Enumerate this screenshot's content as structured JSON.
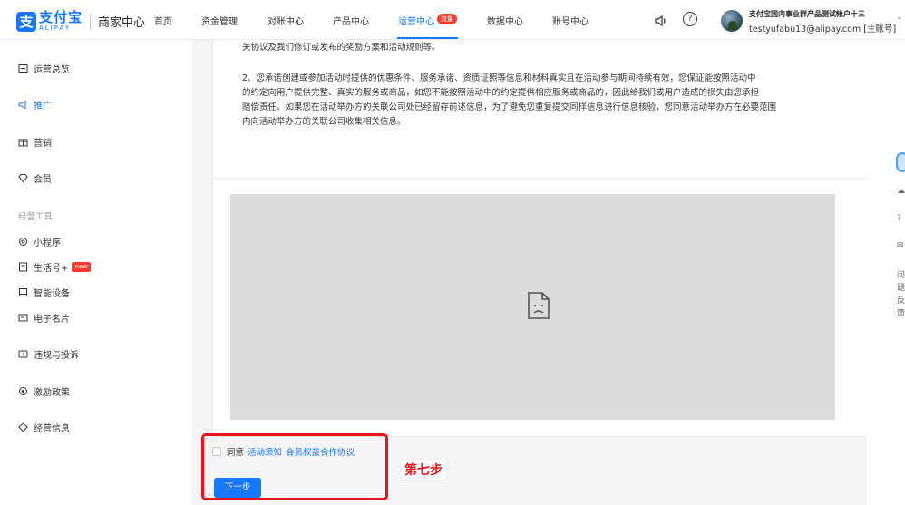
{
  "header": {
    "logo_cn": "支付宝",
    "logo_en": "ALIPAY",
    "app_name": "商家中心",
    "nav": [
      {
        "label": "首页"
      },
      {
        "label": "资金管理"
      },
      {
        "label": "对账中心"
      },
      {
        "label": "产品中心"
      },
      {
        "label": "运营中心",
        "active": true,
        "badge": "流量"
      },
      {
        "label": "数据中心"
      },
      {
        "label": "账号中心"
      }
    ],
    "help_symbol": "?",
    "account_name": "支付宝国内事业群产品测试帐户十三",
    "account_email": "testyufabu13@alipay.com [主账号]"
  },
  "sidebar": {
    "items": [
      {
        "label": "运营总览",
        "icon": "overview-icon"
      },
      {
        "label": "推广",
        "icon": "promotion-icon",
        "active": true
      },
      {
        "label": "营销",
        "icon": "marketing-icon"
      },
      {
        "label": "会员",
        "icon": "member-icon"
      }
    ],
    "group_title": "经营工具",
    "tools": [
      {
        "label": "小程序",
        "icon": "miniapp-icon"
      },
      {
        "label": "生活号+",
        "icon": "lifeaccount-icon",
        "badge": "new"
      },
      {
        "label": "智能设备",
        "icon": "device-icon"
      },
      {
        "label": "电子名片",
        "icon": "card-icon"
      }
    ],
    "bottom": [
      {
        "label": "违规与投诉",
        "icon": "complaint-icon"
      },
      {
        "label": "激励政策",
        "icon": "incentive-icon"
      },
      {
        "label": "经营信息",
        "icon": "business-info-icon"
      }
    ]
  },
  "main": {
    "clipped_line": "关协议及我们修订或发布的奖励方案和活动规则等。",
    "paragraph_lines": [
      "2、您承诺创建或参加活动时提供的优惠条件、服务承诺、资质证照等信息和材料真实且在活动参与期间持续有效，您保证能按照活动中",
      "的约定向用户提供完整、真实的服务或商品，如您不能按照活动中的约定提供相应服务或商品的，因此给我们或用户造成的损失由您承担",
      "赔偿责任。如果您在活动举办方的关联公司处已经留存前述信息，为了避免您重复提交同样信息进行信息核验，您同意活动举办方在必要范围",
      "内向活动举办方的关联公司收集相关信息。"
    ],
    "image_state": "broken-image-icon",
    "agree_prefix": "同意",
    "agree_link_1": "活动须知",
    "agree_link_2": "会员权益合作协议",
    "next_button": "下一步",
    "step_annotation": "第七步"
  },
  "right_panel": {
    "items": [
      "问",
      "题",
      "反",
      "馈"
    ]
  },
  "colors": {
    "brand": "#1677ff",
    "annotation_red": "#e8141a",
    "placeholder_gray": "#dcdcdc"
  }
}
